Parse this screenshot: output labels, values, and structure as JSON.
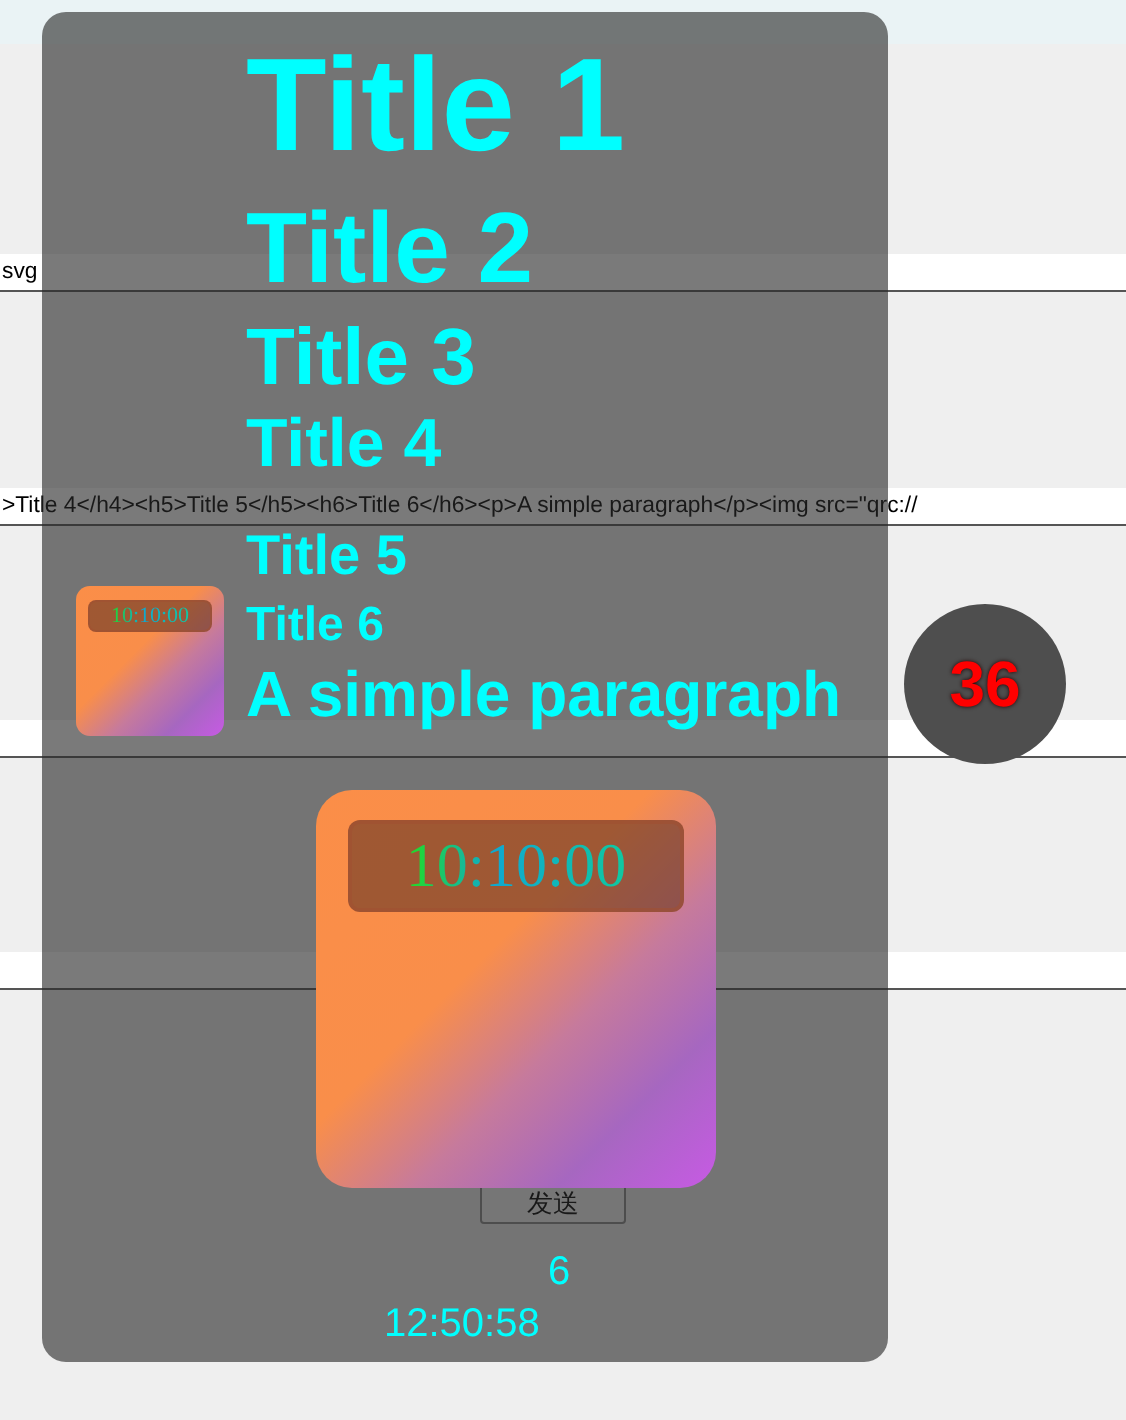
{
  "fields": [
    {
      "value": "svg"
    },
    {
      "value": ">Title 4</h4><h5>Title 5</h5><h6>Title 6</h6><p>A simple paragraph</p><img src=\"qrc://"
    }
  ],
  "send_button": "发送",
  "overlay": {
    "headings": [
      "Title 1",
      "Title 2",
      "Title 3",
      "Title 4",
      "Title 5",
      "Title 6"
    ],
    "paragraph": "A simple paragraph",
    "count": "6",
    "time": "12:50:58"
  },
  "small_clock": {
    "time": "10:10:00"
  },
  "badge": "36",
  "large_clock": {
    "time": "10:10:00"
  }
}
